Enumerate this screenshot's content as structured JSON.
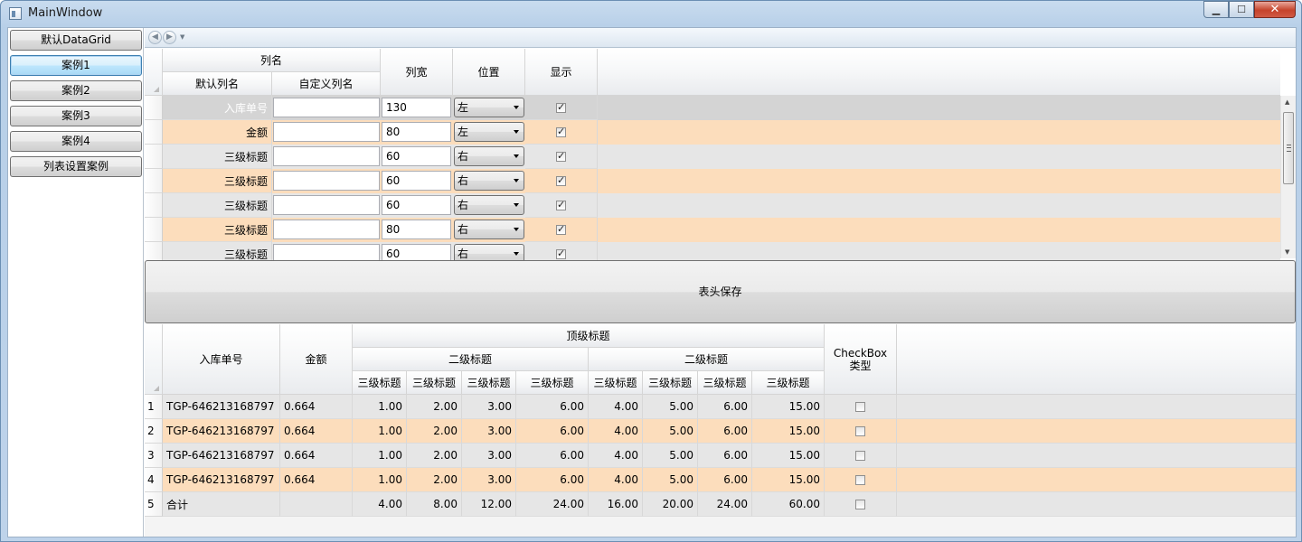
{
  "window": {
    "title": "MainWindow"
  },
  "nav": {
    "items": [
      {
        "label": "默认DataGrid"
      },
      {
        "label": "案例1"
      },
      {
        "label": "案例2"
      },
      {
        "label": "案例3"
      },
      {
        "label": "案例4"
      },
      {
        "label": "列表设置案例"
      }
    ]
  },
  "settings_grid": {
    "headers": {
      "column_name": "列名",
      "default_name": "默认列名",
      "custom_name": "自定义列名",
      "width": "列宽",
      "position": "位置",
      "visible": "显示"
    },
    "rows": [
      {
        "default": "入库单号",
        "custom": "",
        "width": "130",
        "position": "左",
        "visible": true
      },
      {
        "default": "金额",
        "custom": "",
        "width": "80",
        "position": "左",
        "visible": true
      },
      {
        "default": "三级标题",
        "custom": "",
        "width": "60",
        "position": "右",
        "visible": true
      },
      {
        "default": "三级标题",
        "custom": "",
        "width": "60",
        "position": "右",
        "visible": true
      },
      {
        "default": "三级标题",
        "custom": "",
        "width": "60",
        "position": "右",
        "visible": true
      },
      {
        "default": "三级标题",
        "custom": "",
        "width": "80",
        "position": "右",
        "visible": true
      },
      {
        "default": "三级标题",
        "custom": "",
        "width": "60",
        "position": "右",
        "visible": true
      }
    ]
  },
  "save_button": {
    "label": "表头保存"
  },
  "data_grid": {
    "headers": {
      "inbound_no": "入库单号",
      "amount": "金额",
      "top": "顶级标题",
      "second_a": "二级标题",
      "second_b": "二级标题",
      "third": [
        "三级标题",
        "三级标题",
        "三级标题",
        "三级标题",
        "三级标题",
        "三级标题",
        "三级标题",
        "三级标题"
      ],
      "checkbox_type": "CheckBox类型"
    },
    "rows": [
      {
        "num": "1",
        "inbound_no": "TGP-646213168797",
        "amount": "0.664",
        "v": [
          "1.00",
          "2.00",
          "3.00",
          "6.00",
          "4.00",
          "5.00",
          "6.00",
          "15.00"
        ],
        "checked": false
      },
      {
        "num": "2",
        "inbound_no": "TGP-646213168797",
        "amount": "0.664",
        "v": [
          "1.00",
          "2.00",
          "3.00",
          "6.00",
          "4.00",
          "5.00",
          "6.00",
          "15.00"
        ],
        "checked": false
      },
      {
        "num": "3",
        "inbound_no": "TGP-646213168797",
        "amount": "0.664",
        "v": [
          "1.00",
          "2.00",
          "3.00",
          "6.00",
          "4.00",
          "5.00",
          "6.00",
          "15.00"
        ],
        "checked": false
      },
      {
        "num": "4",
        "inbound_no": "TGP-646213168797",
        "amount": "0.664",
        "v": [
          "1.00",
          "2.00",
          "3.00",
          "6.00",
          "4.00",
          "5.00",
          "6.00",
          "15.00"
        ],
        "checked": false
      },
      {
        "num": "5",
        "inbound_no": "合计",
        "amount": "",
        "v": [
          "4.00",
          "8.00",
          "12.00",
          "24.00",
          "16.00",
          "20.00",
          "24.00",
          "60.00"
        ],
        "checked": false
      }
    ]
  },
  "colors": {
    "row_alt": "#fcddbc",
    "row_base": "#e6e6e6",
    "row_selected": "#d4d4d4"
  }
}
